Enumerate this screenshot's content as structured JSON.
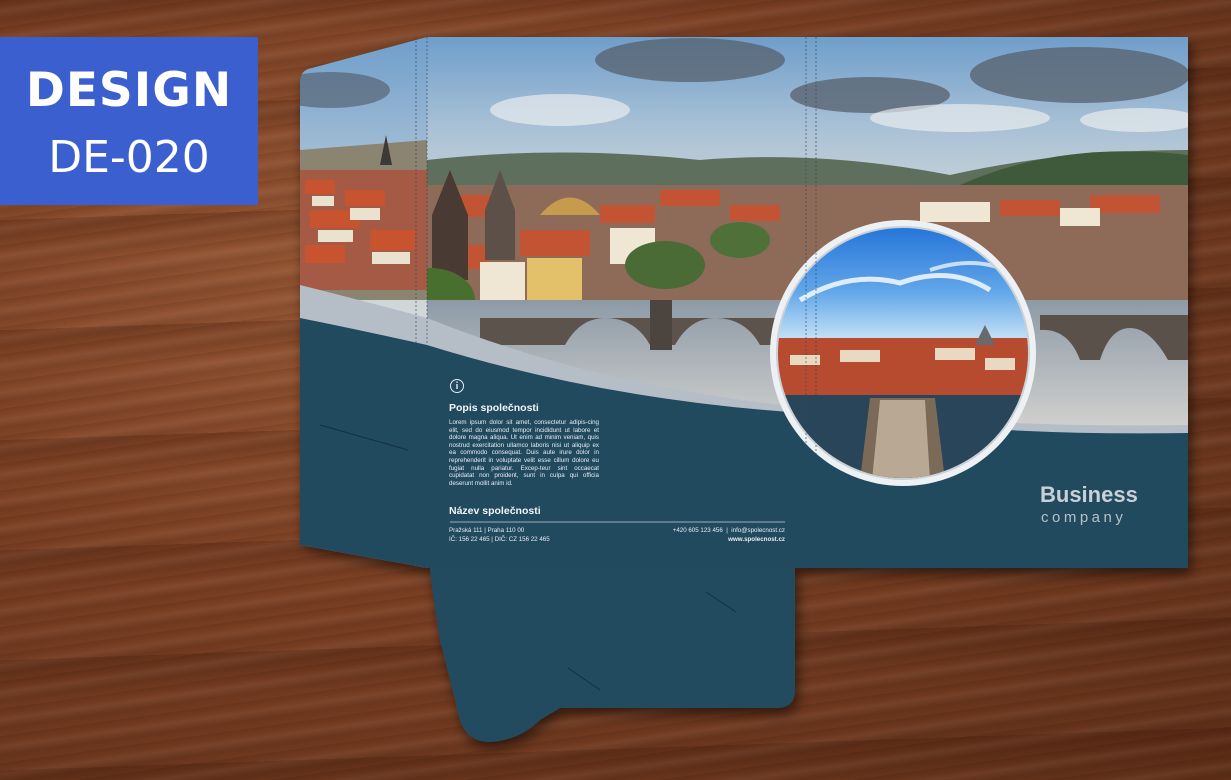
{
  "badge": {
    "line1": "DESIGN",
    "line2": "DE-020"
  },
  "folder": {
    "left_panel": {
      "info_icon": "info-icon",
      "heading": "Popis společnosti",
      "body": "Lorem ipsum dolor sit amet, consectetur adipis-cing elit, sed do eiusmod tempor incididunt ut labore et dolore magna aliqua. Ut enim ad minim veniam, quis nostrud exercitation ullamco laboris nisi ut aliquip ex ea commodo consequat. Duis aute irure dolor in reprehenderit in voluptate velit esse cillum dolore eu fugiat nulla pariatur. Excep-teur sint occaecat cupidatat non proident, sunt in culpa qui officia deserunt mollit anim id.",
      "company_heading": "Název společnosti",
      "address_line1": "Pražská 111 | Praha 110 00",
      "address_line2": "IČ: 156 22 465 | DIČ: CZ 156 22 465",
      "contact_line1": "+420 605 123 456  |  info@spolecnost.cz",
      "contact_line2": "www.spolecnost.cz"
    },
    "brand": {
      "line1": "Business",
      "line2": "company"
    }
  },
  "colors": {
    "badge": "#3c5fd0",
    "folder_navy": "#214a5f",
    "swoosh": "#b5bec6",
    "sky": "#8ab3d8",
    "roofs": "#b04a35"
  }
}
